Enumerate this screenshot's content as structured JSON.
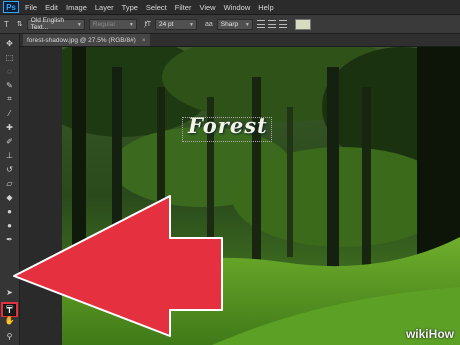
{
  "app": {
    "logo": "Ps"
  },
  "menubar": {
    "items": [
      "File",
      "Edit",
      "Image",
      "Layer",
      "Type",
      "Select",
      "Filter",
      "View",
      "Window",
      "Help"
    ]
  },
  "options": {
    "font_family": "Old English Text...",
    "font_style": "Regular",
    "font_size": "24 pt",
    "antialias": "Sharp",
    "text_color": "#d6dcc0"
  },
  "document": {
    "tab_title": "forest-shadow.jpg @ 27.5% (RGB/8#)"
  },
  "canvas": {
    "overlay_text": "Forest"
  },
  "toolbar": {
    "tools": [
      {
        "name": "move-tool-icon",
        "glyph": "✥"
      },
      {
        "name": "marquee-tool-icon",
        "glyph": "⬚"
      },
      {
        "name": "lasso-tool-icon",
        "glyph": "◌"
      },
      {
        "name": "quick-select-tool-icon",
        "glyph": "✎"
      },
      {
        "name": "crop-tool-icon",
        "glyph": "⌗"
      },
      {
        "name": "eyedropper-tool-icon",
        "glyph": "⁄"
      },
      {
        "name": "healing-brush-tool-icon",
        "glyph": "✚"
      },
      {
        "name": "brush-tool-icon",
        "glyph": "✐"
      },
      {
        "name": "clone-stamp-tool-icon",
        "glyph": "⊥"
      },
      {
        "name": "history-brush-tool-icon",
        "glyph": "↺"
      },
      {
        "name": "eraser-tool-icon",
        "glyph": "▱"
      },
      {
        "name": "paint-bucket-tool-icon",
        "glyph": "◆"
      },
      {
        "name": "blur-tool-icon",
        "glyph": "●"
      },
      {
        "name": "dodge-tool-icon",
        "glyph": "●"
      },
      {
        "name": "pen-tool-icon",
        "glyph": "✒"
      },
      {
        "name": "type-tool-icon",
        "glyph": "T"
      },
      {
        "name": "path-selection-tool-icon",
        "glyph": "➤"
      },
      {
        "name": "shape-tool-icon",
        "glyph": "▭"
      },
      {
        "name": "hand-tool-icon",
        "glyph": "✋"
      },
      {
        "name": "zoom-tool-icon",
        "glyph": "⚲"
      }
    ]
  },
  "watermark": {
    "wiki": "wiki",
    "how": "How"
  },
  "colors": {
    "arrow": "#e53040",
    "arrow_outline": "#ffffff"
  }
}
